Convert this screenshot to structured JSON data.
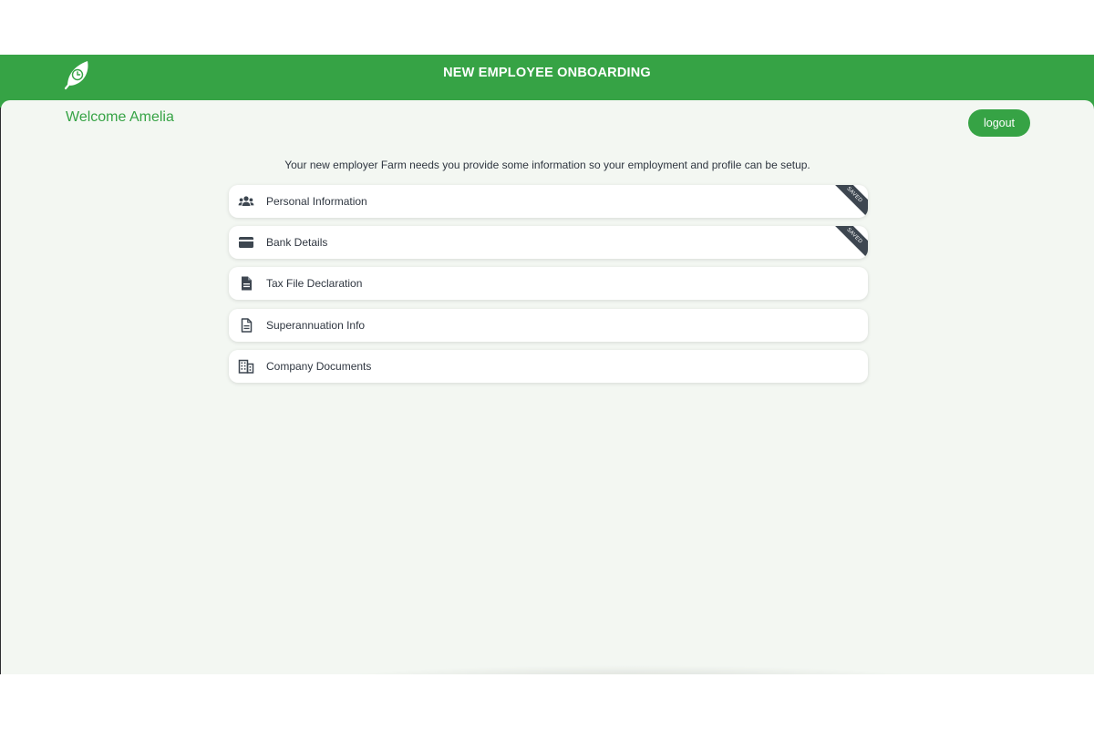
{
  "header": {
    "title": "NEW EMPLOYEE ONBOARDING",
    "logo_icon": "leaf-clock-icon"
  },
  "welcome": "Welcome Amelia",
  "logout_label": "logout",
  "intro": "Your new employer Farm needs you provide some information so your employment and profile can be setup.",
  "items": [
    {
      "label": "Personal Information",
      "icon": "users-icon",
      "badge": "SAVED"
    },
    {
      "label": "Bank Details",
      "icon": "credit-card-icon",
      "badge": "SAVED"
    },
    {
      "label": "Tax File Declaration",
      "icon": "document-filled-icon"
    },
    {
      "label": "Superannuation Info",
      "icon": "document-outline-icon"
    },
    {
      "label": "Company Documents",
      "icon": "building-icon"
    }
  ],
  "colors": {
    "brand_green": "#36a345",
    "panel_background": "#f3f7f2",
    "ribbon": "#3d4650",
    "text": "#2f3640"
  }
}
